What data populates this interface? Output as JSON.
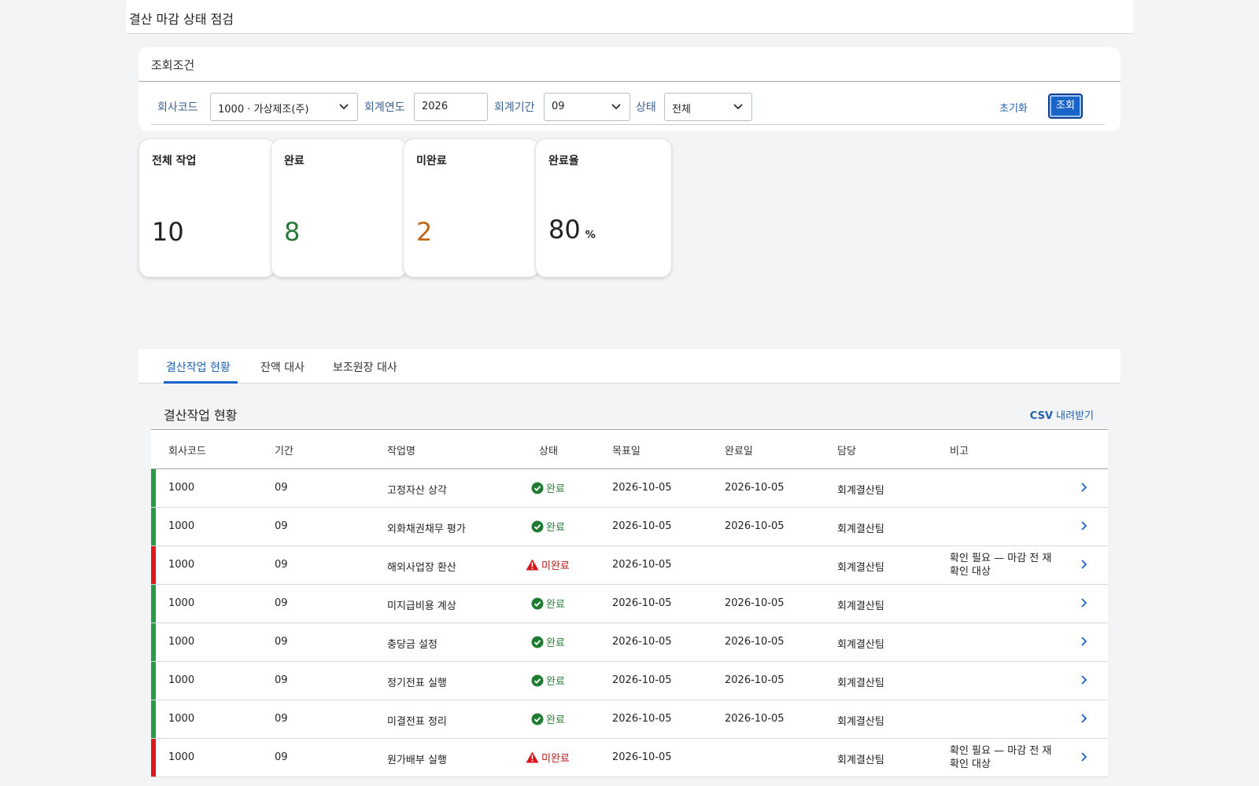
{
  "header": {
    "title": "결산 마감 상태 점검"
  },
  "filter": {
    "card_title": "조회조건",
    "company_label": "회사코드",
    "company_value": "1000 · 가상제조(주)",
    "year_label": "회계연도",
    "year_value": "2026",
    "period_label": "회계기간",
    "period_value": "09",
    "status_label": "상태",
    "status_value": "전체",
    "reset_label": "초기화",
    "search_label": "조회"
  },
  "kpis": [
    {
      "label": "전체 작업",
      "value": "10",
      "unit": "",
      "color": "#222222"
    },
    {
      "label": "완료",
      "value": "8",
      "unit": "",
      "color": "#2a7a3a"
    },
    {
      "label": "미완료",
      "value": "2",
      "unit": "",
      "color": "#c0681a"
    },
    {
      "label": "완료율",
      "value": "80",
      "unit": "%",
      "color": "#222222"
    }
  ],
  "tabs": [
    {
      "label": "결산작업 현황",
      "active": true
    },
    {
      "label": "잔액 대사",
      "active": false
    },
    {
      "label": "보조원장 대사",
      "active": false
    }
  ],
  "section": {
    "title": "결산작업 현황",
    "csv_prefix": "CSV",
    "csv_label": "내려받기"
  },
  "table": {
    "columns": [
      "회사코드",
      "기간",
      "작업명",
      "상태",
      "목표일",
      "완료일",
      "담당",
      "비고"
    ],
    "rows": [
      {
        "company": "1000",
        "period": "09",
        "task": "고정자산 상각",
        "status": "완료",
        "ok": true,
        "target": "2026-10-05",
        "done": "2026-10-05",
        "owner": "회계결산팀",
        "note": ""
      },
      {
        "company": "1000",
        "period": "09",
        "task": "외화채권채무 평가",
        "status": "완료",
        "ok": true,
        "target": "2026-10-05",
        "done": "2026-10-05",
        "owner": "회계결산팀",
        "note": ""
      },
      {
        "company": "1000",
        "period": "09",
        "task": "해외사업장 환산",
        "status": "미완료",
        "ok": false,
        "target": "2026-10-05",
        "done": "",
        "owner": "회계결산팀",
        "note": "확인 필요 — 마감 전 재확인 대상"
      },
      {
        "company": "1000",
        "period": "09",
        "task": "미지급비용 계상",
        "status": "완료",
        "ok": true,
        "target": "2026-10-05",
        "done": "2026-10-05",
        "owner": "회계결산팀",
        "note": ""
      },
      {
        "company": "1000",
        "period": "09",
        "task": "충당금 설정",
        "status": "완료",
        "ok": true,
        "target": "2026-10-05",
        "done": "2026-10-05",
        "owner": "회계결산팀",
        "note": ""
      },
      {
        "company": "1000",
        "period": "09",
        "task": "정기전표 실행",
        "status": "완료",
        "ok": true,
        "target": "2026-10-05",
        "done": "2026-10-05",
        "owner": "회계결산팀",
        "note": ""
      },
      {
        "company": "1000",
        "period": "09",
        "task": "미결전표 정리",
        "status": "완료",
        "ok": true,
        "target": "2026-10-05",
        "done": "2026-10-05",
        "owner": "회계결산팀",
        "note": ""
      },
      {
        "company": "1000",
        "period": "09",
        "task": "원가배부 실행",
        "status": "미완료",
        "ok": false,
        "target": "2026-10-05",
        "done": "",
        "owner": "회계결산팀",
        "note": "확인 필요 — 마감 전 재확인 대상"
      }
    ]
  },
  "colors": {
    "accent": "#1a64c8",
    "ok": "#2a9a45",
    "bad": "#e0161b",
    "label": "#3b5f8c"
  },
  "icons": {
    "ok": "check-circle-icon",
    "bad": "warning-triangle-icon",
    "row": "chevron-right-icon",
    "select": "chevron-down-icon"
  }
}
